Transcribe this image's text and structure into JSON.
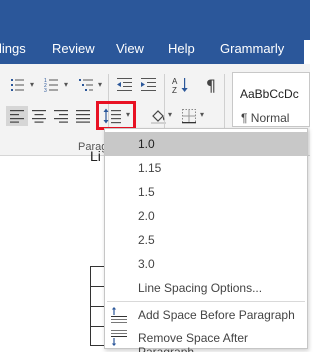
{
  "tabs": [
    "lings",
    "Review",
    "View",
    "Help",
    "Grammarly"
  ],
  "ribbon": {
    "group_label": "Paragr",
    "styles": {
      "preview": "AaBbCcDc",
      "name": "¶ Normal"
    }
  },
  "document": {
    "fragment": "Li"
  },
  "line_spacing_menu": {
    "options": [
      "1.0",
      "1.15",
      "1.5",
      "2.0",
      "2.5",
      "3.0"
    ],
    "selected": "1.0",
    "more_options": "Line Spacing Options...",
    "add_space_before": "Add Space Before Paragraph",
    "remove_space_after": "Remove Space After Paragraph"
  },
  "colors": {
    "tab_bar": "#2b579a",
    "highlight_border": "#e81123",
    "selected_item": "#c8c8c8",
    "accent_blue": "#2b579a"
  }
}
